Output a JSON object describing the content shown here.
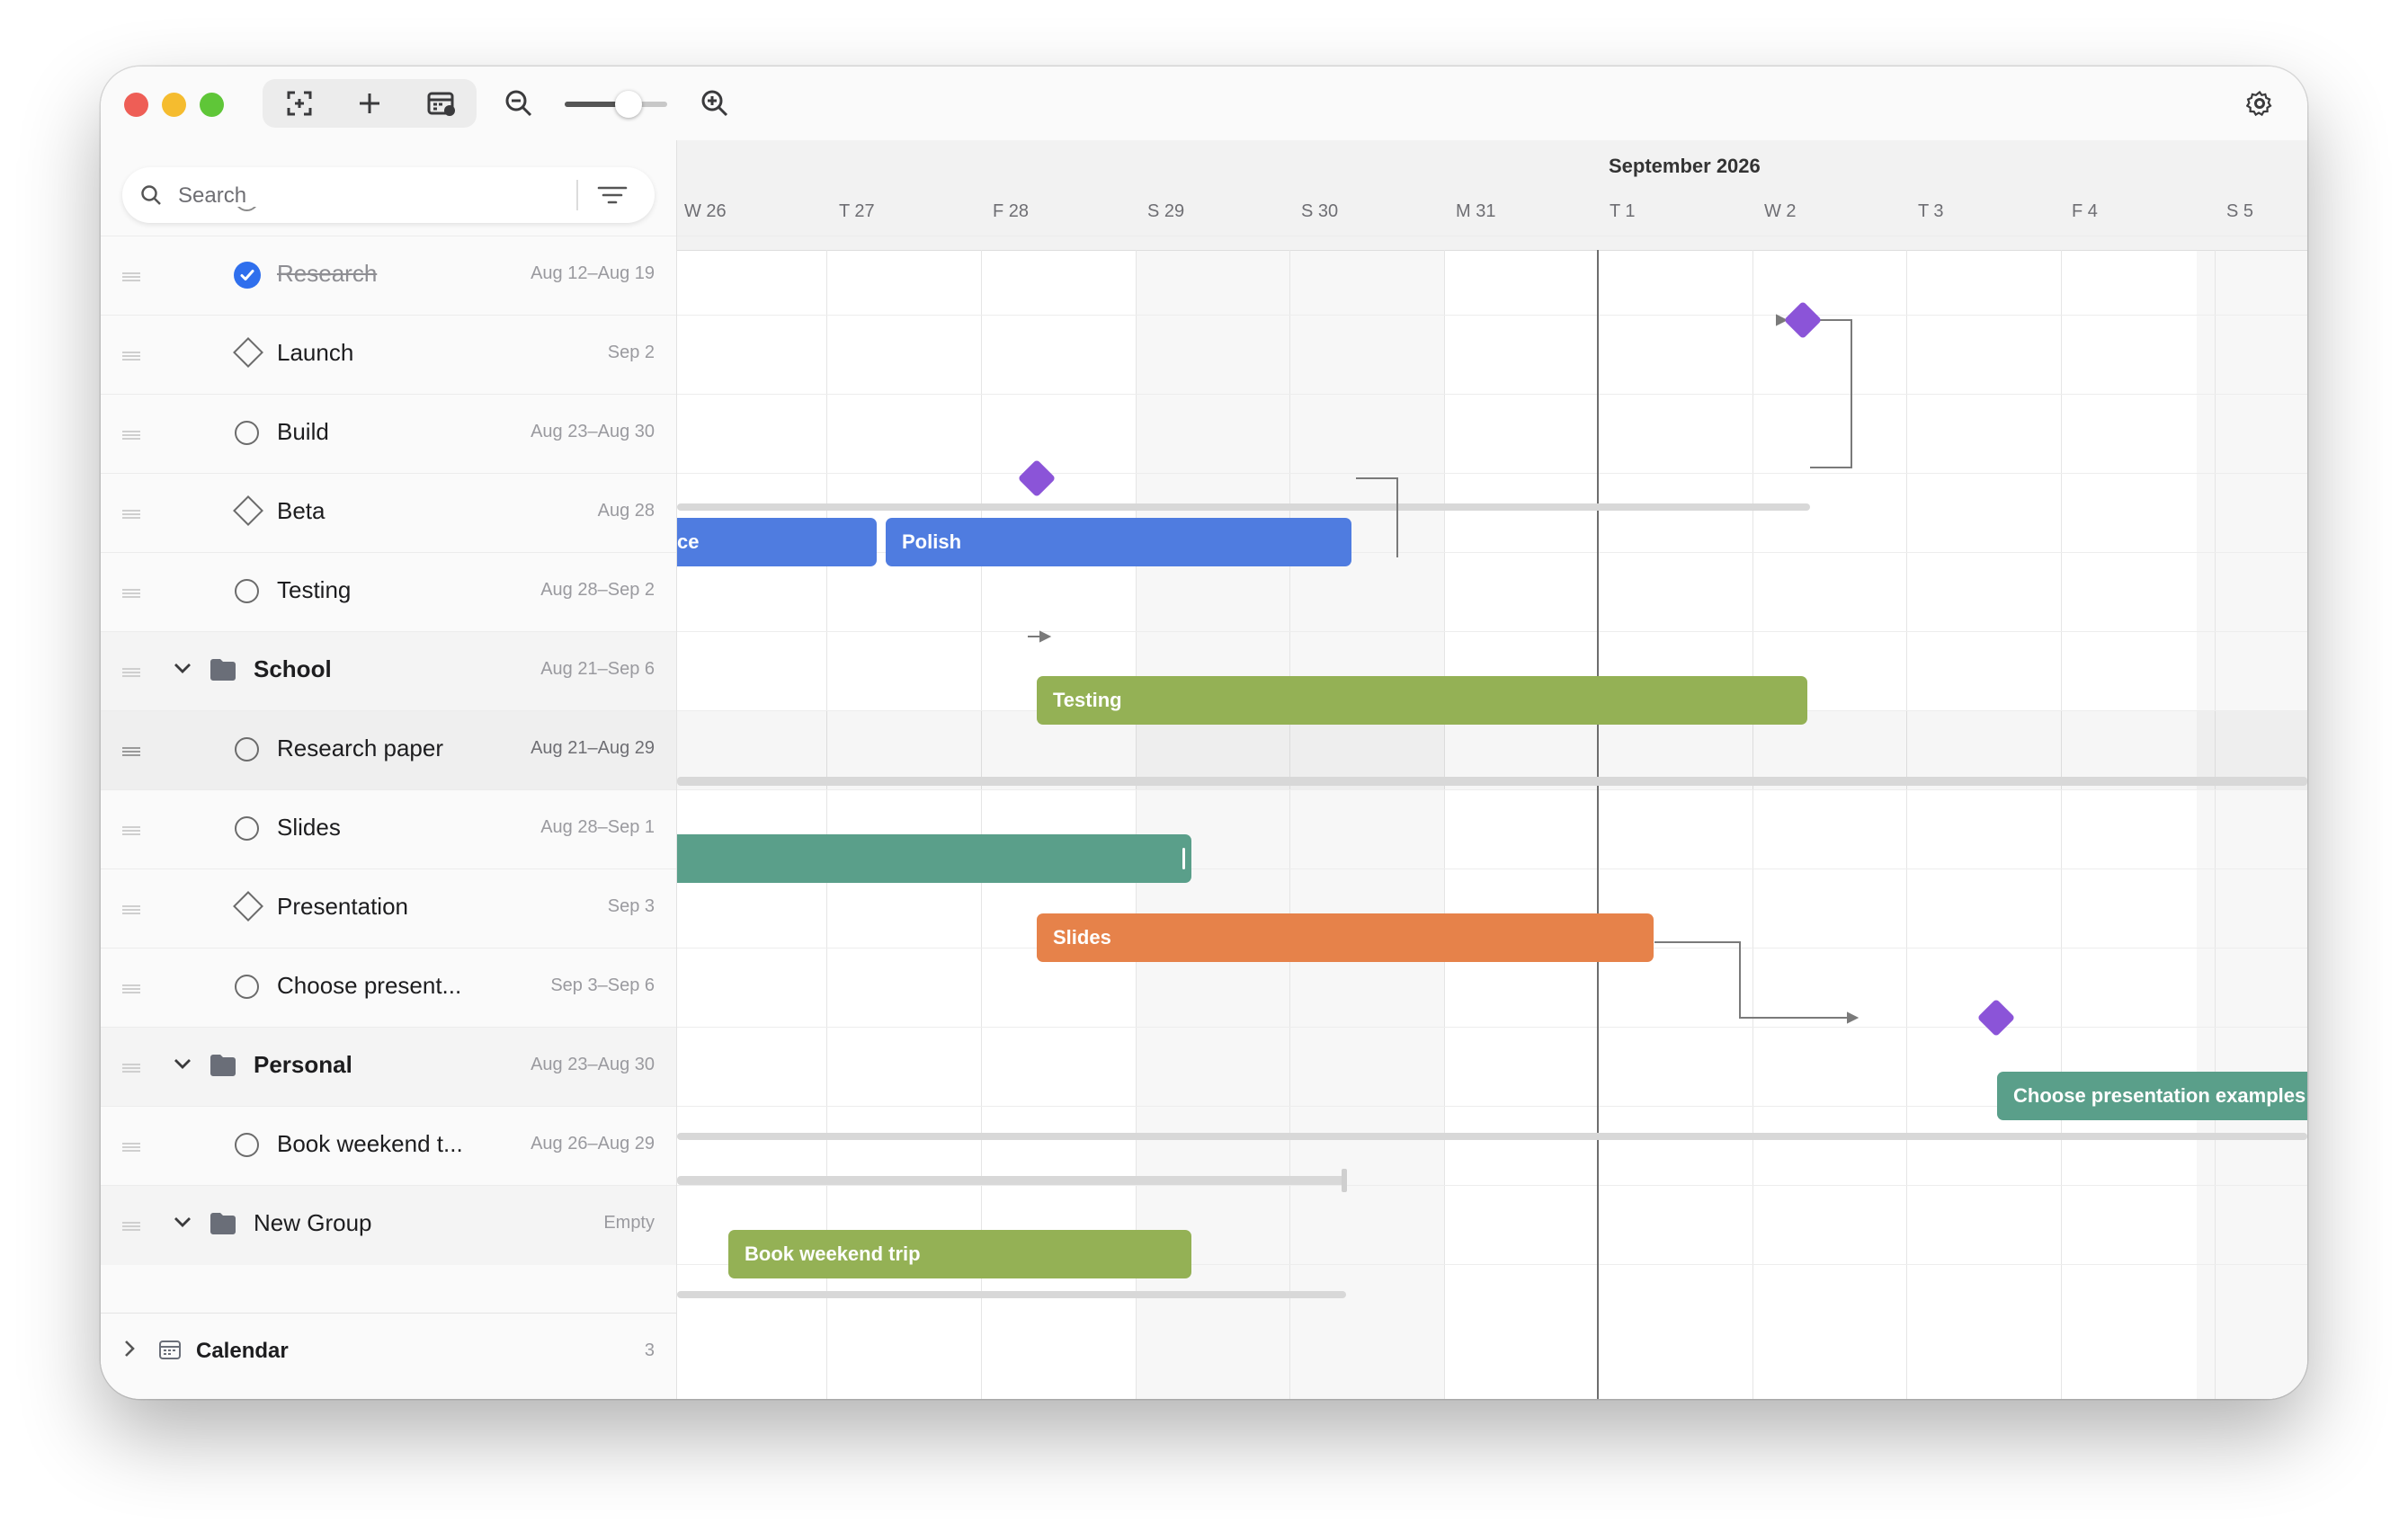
{
  "toolbar": {
    "icons": [
      "focus-icon",
      "plus-icon",
      "calendar-add-icon",
      "zoom-out-icon",
      "zoom-in-icon",
      "gear-icon"
    ],
    "zoom_level": 0.55
  },
  "search": {
    "placeholder": "Search"
  },
  "tasks": [
    {
      "title": "Research",
      "date": "Aug 12–Aug 19",
      "kind": "task",
      "done": true
    },
    {
      "title": "Launch",
      "date": "Sep 2",
      "kind": "milestone"
    },
    {
      "title": "Build",
      "date": "Aug 23–Aug 30",
      "kind": "task"
    },
    {
      "title": "Beta",
      "date": "Aug 28",
      "kind": "milestone"
    },
    {
      "title": "Testing",
      "date": "Aug 28–Sep 2",
      "kind": "task"
    },
    {
      "title": "School",
      "date": "Aug 21–Sep 6",
      "kind": "group"
    },
    {
      "title": "Research paper",
      "date": "Aug 21–Aug 29",
      "kind": "task"
    },
    {
      "title": "Slides",
      "date": "Aug 28–Sep 1",
      "kind": "task"
    },
    {
      "title": "Presentation",
      "date": "Sep 3",
      "kind": "milestone"
    },
    {
      "title": "Choose present...",
      "date": "Sep 3–Sep 6",
      "kind": "task"
    },
    {
      "title": "Personal",
      "date": "Aug 23–Aug 30",
      "kind": "group"
    },
    {
      "title": "Book weekend t...",
      "date": "Aug 26–Aug 29",
      "kind": "task"
    },
    {
      "title": "New Group",
      "date": "Empty",
      "kind": "group"
    }
  ],
  "footer": {
    "label": "Calendar",
    "count": "3"
  },
  "timeline": {
    "month": "September 2026",
    "days": [
      "W 26",
      "T 27",
      "F 28",
      "S 29",
      "S 30",
      "M 31",
      "T 1",
      "W 2",
      "T 3",
      "F 4",
      "S 5"
    ],
    "bars": {
      "build_prev": "ce",
      "polish": "Polish",
      "testing": "Testing",
      "slides": "Slides",
      "choose": "Choose presentation examples",
      "book": "Book weekend trip"
    }
  },
  "colors": {
    "blue": "#4f7ce0",
    "green": "#94b155",
    "teal": "#5a9f8a",
    "orange": "#e6824a",
    "milestone": "#8b54d8",
    "check": "#2f6fed"
  }
}
